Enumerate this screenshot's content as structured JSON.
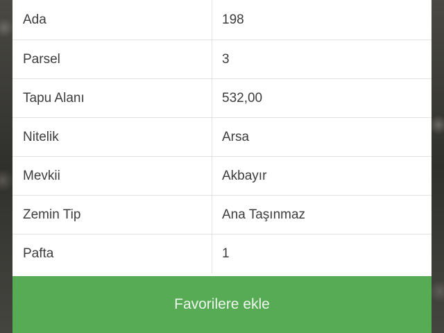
{
  "details": {
    "rows": [
      {
        "key": "Ada",
        "value": "198"
      },
      {
        "key": "Parsel",
        "value": "3"
      },
      {
        "key": "Tapu Alanı",
        "value": "532,00"
      },
      {
        "key": "Nitelik",
        "value": "Arsa"
      },
      {
        "key": "Mevkii",
        "value": "Akbayır"
      },
      {
        "key": "Zemin Tip",
        "value": "Ana Taşınmaz"
      },
      {
        "key": "Pafta",
        "value": "1"
      }
    ]
  },
  "actions": {
    "favorite_label": "Favorilere ekle",
    "favorite_color": "#57ab55"
  }
}
